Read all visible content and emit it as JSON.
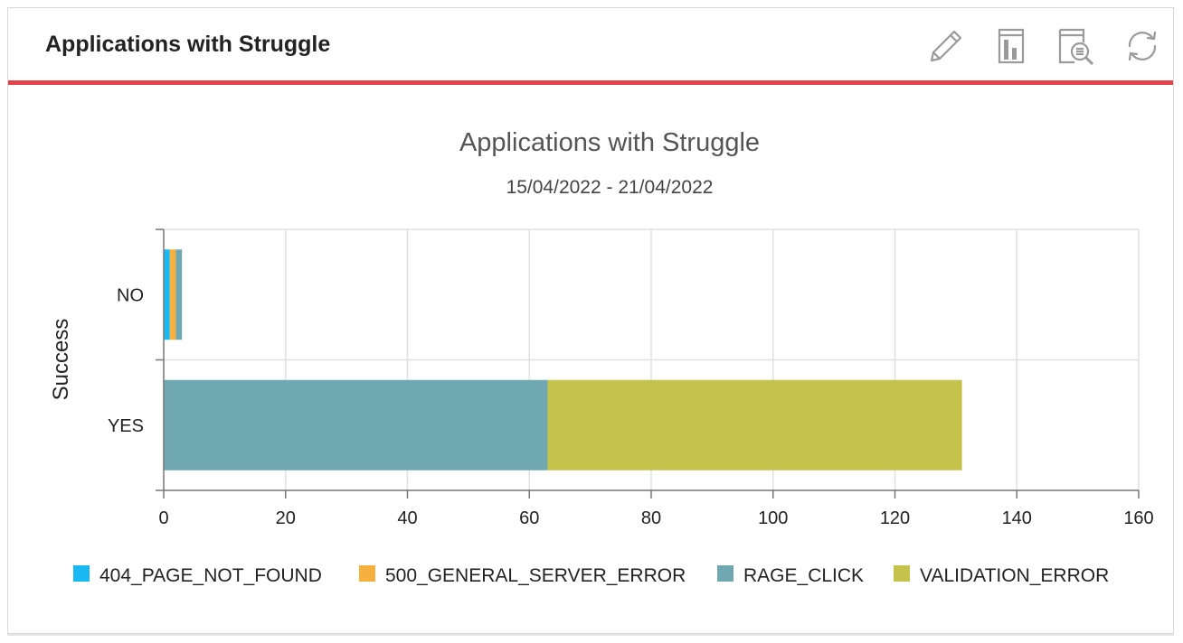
{
  "panel": {
    "title": "Applications with Struggle",
    "tools": [
      {
        "name": "edit",
        "icon": "pencil-icon"
      },
      {
        "name": "report",
        "icon": "bar-report-icon"
      },
      {
        "name": "inspect",
        "icon": "document-search-icon"
      },
      {
        "name": "refresh",
        "icon": "refresh-icon"
      }
    ],
    "accent_color": "#e2434b"
  },
  "chart_data": {
    "type": "bar",
    "orientation": "horizontal",
    "stacked": true,
    "title": "Applications with Struggle",
    "subtitle": "15/04/2022 - 21/04/2022",
    "xlabel": "",
    "ylabel": "Success",
    "categories": [
      "NO",
      "YES"
    ],
    "xlim": [
      0,
      160
    ],
    "xticks": [
      0,
      20,
      40,
      60,
      80,
      100,
      120,
      140,
      160
    ],
    "grid": true,
    "legend_position": "bottom",
    "series": [
      {
        "name": "404_PAGE_NOT_FOUND",
        "color": "#18b8f2",
        "values": [
          1,
          0
        ]
      },
      {
        "name": "500_GENERAL_SERVER_ERROR",
        "color": "#f5b03d",
        "values": [
          1,
          0
        ]
      },
      {
        "name": "RAGE_CLICK",
        "color": "#6fa8b0",
        "values": [
          1,
          63
        ]
      },
      {
        "name": "VALIDATION_ERROR",
        "color": "#c5c34b",
        "values": [
          0,
          68
        ]
      }
    ]
  }
}
